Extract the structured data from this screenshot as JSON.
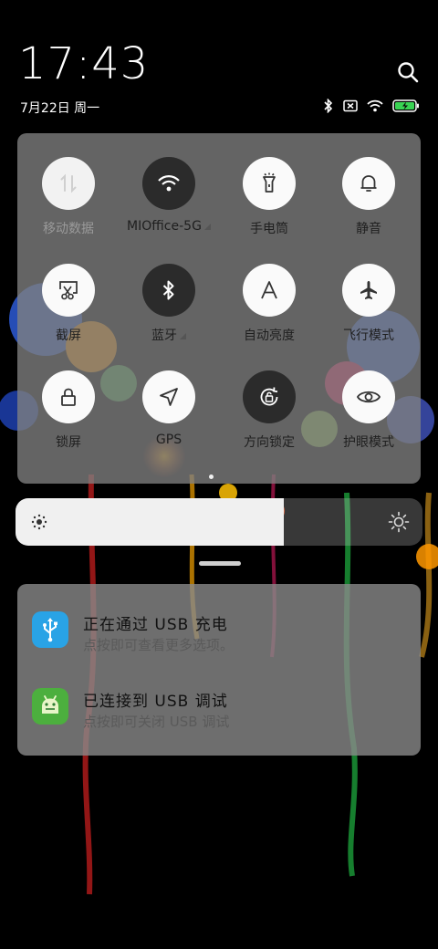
{
  "statusbar": {
    "time": "17:43",
    "date": "7月22日 周一",
    "icons": [
      "bluetooth-icon",
      "sim-disabled-icon",
      "wifi-icon",
      "battery-charging-icon"
    ]
  },
  "quick_settings": {
    "tiles": [
      {
        "label": "移动数据",
        "state": "disabled",
        "icon": "mobile-data-icon"
      },
      {
        "label": "MIOffice-5G",
        "state": "on",
        "icon": "wifi-icon"
      },
      {
        "label": "手电筒",
        "state": "off",
        "icon": "flashlight-icon"
      },
      {
        "label": "静音",
        "state": "off",
        "icon": "bell-icon"
      },
      {
        "label": "截屏",
        "state": "off",
        "icon": "screenshot-icon"
      },
      {
        "label": "蓝牙",
        "state": "on",
        "icon": "bluetooth-icon"
      },
      {
        "label": "自动亮度",
        "state": "off",
        "icon": "auto-brightness-icon"
      },
      {
        "label": "飞行模式",
        "state": "off",
        "icon": "airplane-icon"
      },
      {
        "label": "锁屏",
        "state": "off",
        "icon": "lock-icon"
      },
      {
        "label": "GPS",
        "state": "off",
        "icon": "location-icon"
      },
      {
        "label": "方向锁定",
        "state": "on",
        "icon": "rotation-lock-icon"
      },
      {
        "label": "护眼模式",
        "state": "off",
        "icon": "eye-icon"
      }
    ]
  },
  "brightness": {
    "level": 0.66
  },
  "notifications": [
    {
      "title": "正在通过 USB 充电",
      "subtitle": "点按即可查看更多选项。",
      "icon": "usb-icon",
      "color": "#29a3e6"
    },
    {
      "title": "已连接到 USB 调试",
      "subtitle": "点按即可关闭 USB 调试",
      "icon": "android-icon",
      "color": "#4caf3e"
    }
  ]
}
